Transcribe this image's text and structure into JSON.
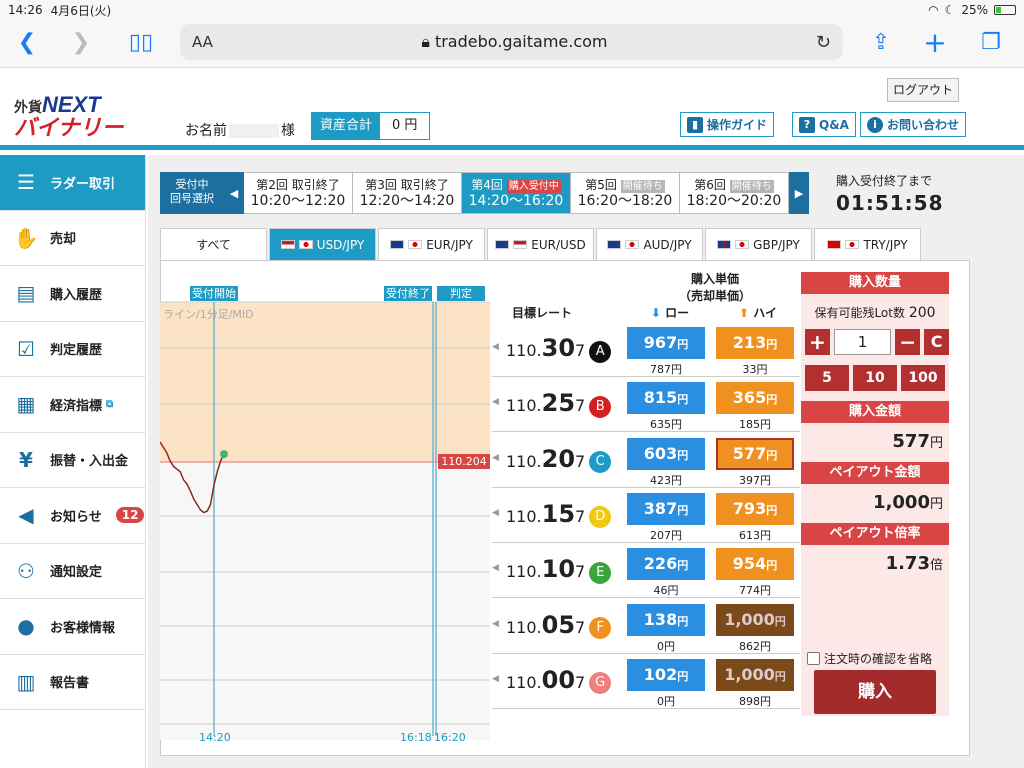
{
  "status": {
    "time": "14:26",
    "date": "4月6日(火)",
    "battery": "25%"
  },
  "browser": {
    "aa": "AA",
    "url": "tradebo.gaitame.com"
  },
  "header": {
    "logo_small": "外貨",
    "logo_big": "NEXT",
    "logo_sub": "バイナリー",
    "name_label": "お名前",
    "name_suffix": "様",
    "assets_label": "資産合計",
    "assets_value": "0 円",
    "logout": "ログアウト",
    "guide": "操作ガイド",
    "qa": "Q&A",
    "contact": "お問い合わせ"
  },
  "sidebar": [
    {
      "label": "ラダー取引",
      "icon": "ladder-icon",
      "glyph": "☰"
    },
    {
      "label": "売却",
      "icon": "sell-hand-icon",
      "glyph": "✋"
    },
    {
      "label": "購入履歴",
      "icon": "purchase-history-icon",
      "glyph": "▤"
    },
    {
      "label": "判定履歴",
      "icon": "judgement-history-icon",
      "glyph": "☑"
    },
    {
      "label": "経済指標",
      "icon": "calendar-icon",
      "glyph": "▦"
    },
    {
      "label": "振替・入出金",
      "icon": "yen-coin-icon",
      "glyph": "¥"
    },
    {
      "label": "お知らせ",
      "icon": "megaphone-icon",
      "glyph": "◀",
      "badge": "12"
    },
    {
      "label": "通知設定",
      "icon": "bell-icon",
      "glyph": "⚇"
    },
    {
      "label": "お客様情報",
      "icon": "user-icon",
      "glyph": "●"
    },
    {
      "label": "報告書",
      "icon": "clipboard-icon",
      "glyph": "▥"
    }
  ],
  "rounds": {
    "selector_line1": "受付中",
    "selector_line2": "回号選択",
    "items": [
      {
        "num": "第2回",
        "status": "取引終了",
        "time": "10:20〜12:20"
      },
      {
        "num": "第3回",
        "status": "取引終了",
        "time": "12:20〜14:20"
      },
      {
        "num": "第4回",
        "status": "購入受付中",
        "time": "14:20〜16:20"
      },
      {
        "num": "第5回",
        "status": "開催待ち",
        "time": "16:20〜18:20"
      },
      {
        "num": "第6回",
        "status": "開催待ち",
        "time": "18:20〜20:20"
      }
    ]
  },
  "countdown": {
    "label": "購入受付終了まで",
    "value": "01:51:58"
  },
  "currency_tabs": [
    "すべて",
    "USD/JPY",
    "EUR/JPY",
    "EUR/USD",
    "AUD/JPY",
    "GBP/JPY",
    "TRY/JPY"
  ],
  "chart": {
    "label_open": "受付開始",
    "label_close": "受付終了",
    "label_judge": "判定",
    "mode": "ライン/1分足/MID",
    "current_price": "110.204",
    "x_labels": [
      "14:20",
      "16:18",
      "16:20"
    ],
    "series": [
      0.56,
      0.52,
      0.48,
      0.42,
      0.38,
      0.36,
      0.34,
      0.28,
      0.25,
      0.2,
      0.14,
      0.1,
      0.06,
      0.04,
      0.05,
      0.1,
      0.24,
      0.34,
      0.42,
      0.47
    ]
  },
  "table_head": {
    "target": "目標レート",
    "unit1": "購入単価",
    "unit2": "（売却単価）",
    "low": "ロー",
    "high": "ハイ"
  },
  "rows": [
    {
      "prefix": "110.",
      "big": "30",
      "suffix": "7",
      "letter": "A",
      "color": "#111111",
      "low": "967",
      "low_sub": "787円",
      "high": "213",
      "high_sub": "33円",
      "state": "normal"
    },
    {
      "prefix": "110.",
      "big": "25",
      "suffix": "7",
      "letter": "B",
      "color": "#d42020",
      "low": "815",
      "low_sub": "635円",
      "high": "365",
      "high_sub": "185円",
      "state": "normal"
    },
    {
      "prefix": "110.",
      "big": "20",
      "suffix": "7",
      "letter": "C",
      "color": "#1d9bc4",
      "low": "603",
      "low_sub": "423円",
      "high": "577",
      "high_sub": "397円",
      "state": "selected"
    },
    {
      "prefix": "110.",
      "big": "15",
      "suffix": "7",
      "letter": "D",
      "color": "#f2c811",
      "low": "387",
      "low_sub": "207円",
      "high": "793",
      "high_sub": "613円",
      "state": "normal"
    },
    {
      "prefix": "110.",
      "big": "10",
      "suffix": "7",
      "letter": "E",
      "color": "#3aa53a",
      "low": "226",
      "low_sub": "46円",
      "high": "954",
      "high_sub": "774円",
      "state": "normal"
    },
    {
      "prefix": "110.",
      "big": "05",
      "suffix": "7",
      "letter": "F",
      "color": "#f0901e",
      "low": "138",
      "low_sub": "0円",
      "high": "1,000",
      "high_sub": "862円",
      "state": "disabled"
    },
    {
      "prefix": "110.",
      "big": "00",
      "suffix": "7",
      "letter": "G",
      "color": "#f08080",
      "low": "102",
      "low_sub": "0円",
      "high": "1,000",
      "high_sub": "898円",
      "state": "disabled"
    }
  ],
  "yen": "円",
  "order": {
    "qty_title": "購入数量",
    "lots_label": "保有可能残Lot数",
    "lots_value": "200",
    "qty": "1",
    "plus": "+",
    "minus": "−",
    "clear": "C",
    "q5": "5",
    "q10": "10",
    "q100": "100",
    "amount_title": "購入金額",
    "amount": "577",
    "payout_title": "ペイアウト金額",
    "payout": "1,000",
    "rate_title": "ペイアウト倍率",
    "rate": "1.73",
    "rate_unit": "倍",
    "skip": "注文時の確認を省略",
    "buy": "購入"
  }
}
